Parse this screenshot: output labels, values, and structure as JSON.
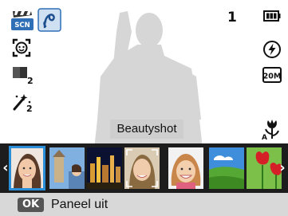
{
  "top_bar": {
    "scene_mode": "SCN",
    "shot_count": "1",
    "resolution": "20M"
  },
  "left_icons": [
    "scene-mode-icon",
    "face-detection-icon",
    "ev-compensation-icon",
    "beauty-retouch-icon"
  ],
  "right_icons": [
    "battery-icon",
    "flash-icon",
    "resolution-icon",
    "macro-icon"
  ],
  "mode_label": "Beautyshot",
  "filmstrip": {
    "items": [
      {
        "name": "beauty-portrait",
        "selected": true
      },
      {
        "name": "landmark-portrait",
        "selected": false
      },
      {
        "name": "night-scene",
        "selected": false
      },
      {
        "name": "frame-guide",
        "selected": false
      },
      {
        "name": "child-portrait",
        "selected": false
      },
      {
        "name": "landscape",
        "selected": false
      },
      {
        "name": "flower-closeup",
        "selected": false
      }
    ]
  },
  "footer": {
    "ok_label": "OK",
    "action_label": "Paneel uit"
  },
  "colors": {
    "selection": "#2a8fd8",
    "filmstrip_bg": "#1d1d1d",
    "footer_bg": "#d8d8d8"
  }
}
